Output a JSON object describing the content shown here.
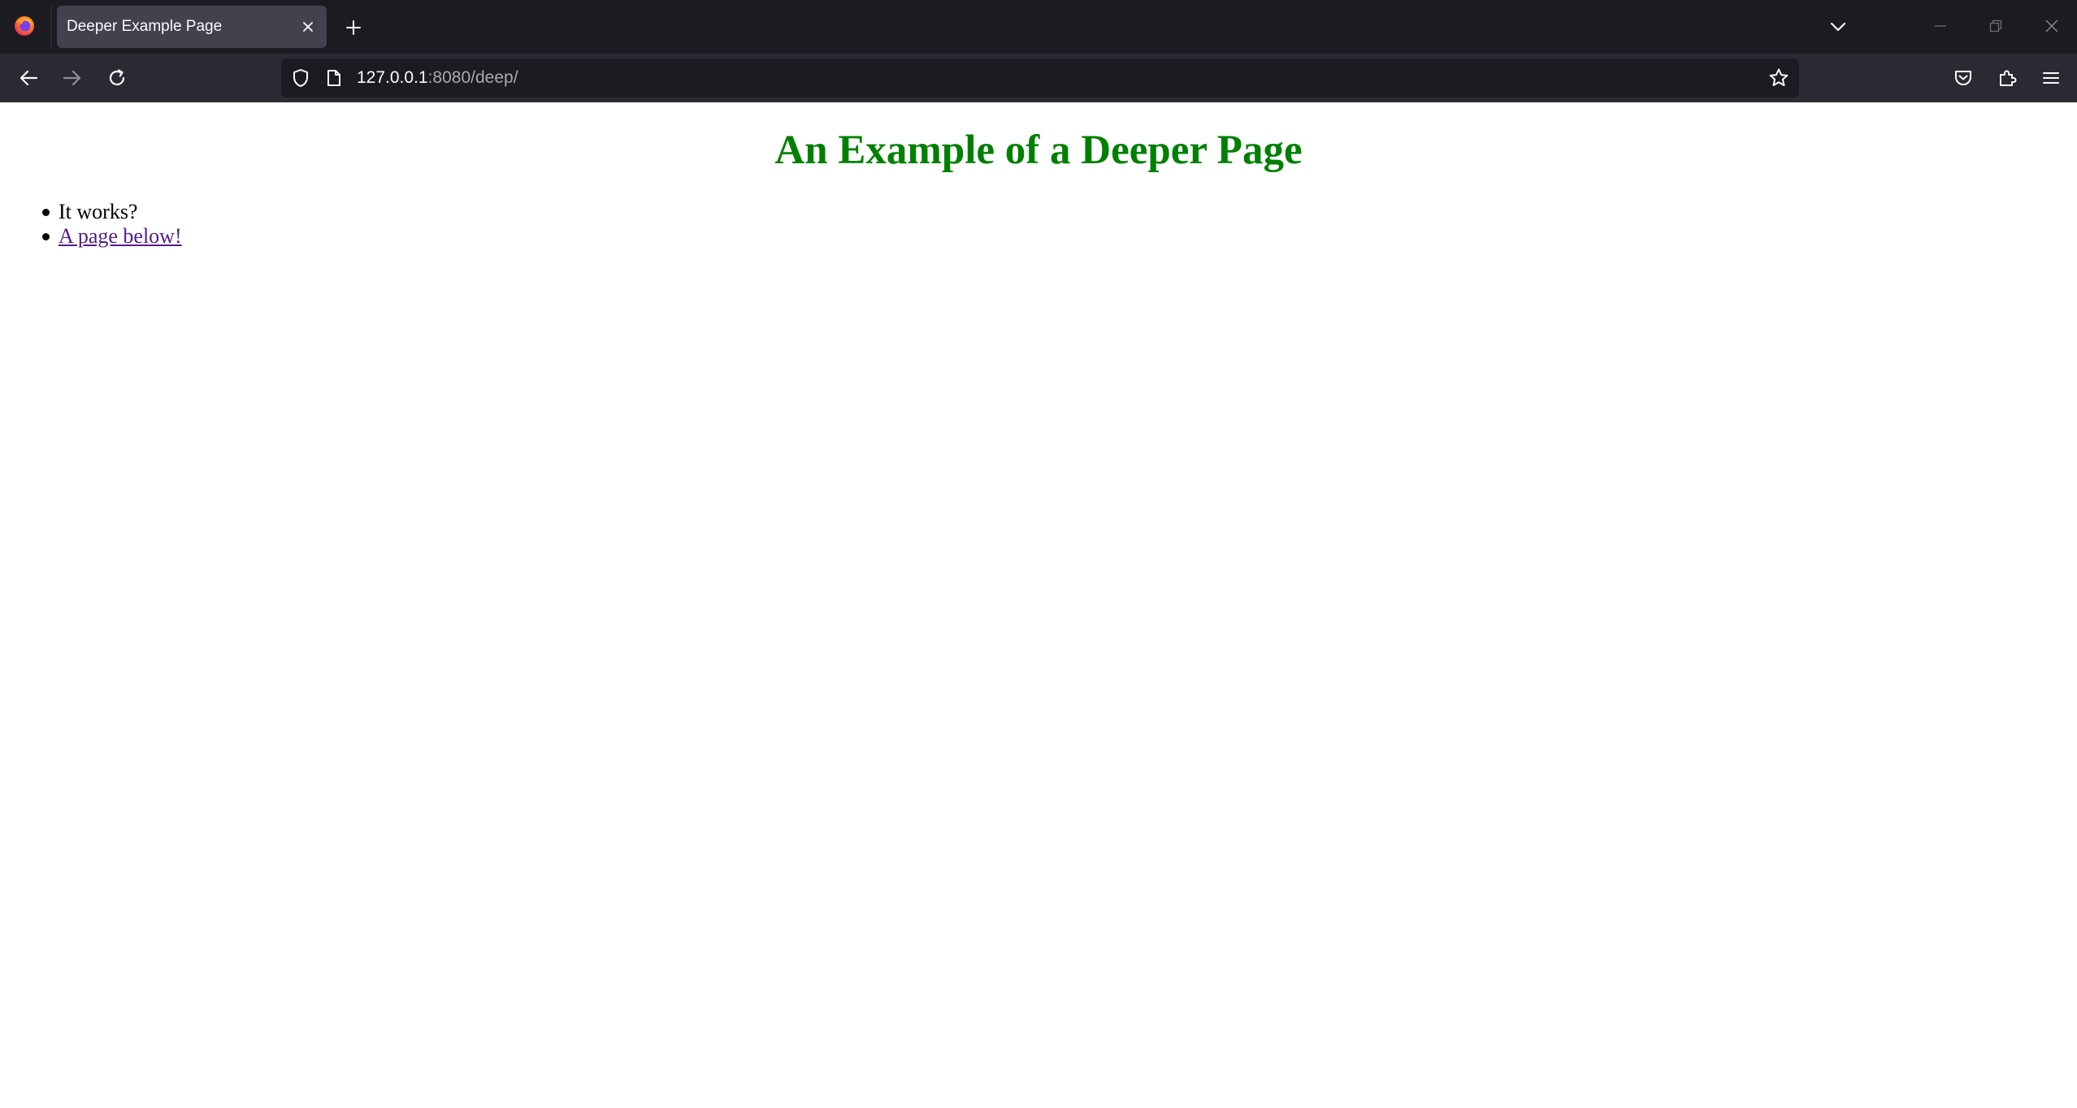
{
  "browser": {
    "tab": {
      "title": "Deeper Example Page"
    },
    "url": {
      "host": "127.0.0.1",
      "rest": ":8080/deep/"
    }
  },
  "page": {
    "heading": "An Example of a Deeper Page",
    "items": [
      {
        "text": "It works?"
      },
      {
        "text": "A page below!"
      }
    ]
  },
  "colors": {
    "heading": "#008000",
    "link_visited": "#551a8b",
    "tabstrip_bg": "#1c1b22",
    "navbar_bg": "#2b2a33"
  },
  "icons": [
    "firefox-logo-icon",
    "close-icon",
    "plus-icon",
    "chevron-down-icon",
    "minimize-icon",
    "restore-icon",
    "close-window-icon",
    "back-arrow-icon",
    "forward-arrow-icon",
    "reload-icon",
    "shield-icon",
    "page-icon",
    "star-icon",
    "pocket-icon",
    "extensions-icon",
    "menu-icon"
  ]
}
